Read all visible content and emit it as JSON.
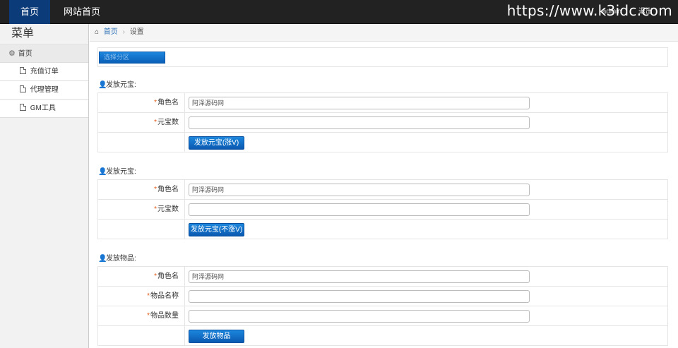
{
  "topbar": {
    "home": "首页",
    "site_home": "网站首页",
    "right_link_1": "admin",
    "right_link_2": "退出",
    "watermark": "https://www.k3idc.com"
  },
  "sidebar": {
    "title": "菜单",
    "home": "首页",
    "items": [
      {
        "label": "充值订单"
      },
      {
        "label": "代理管理"
      },
      {
        "label": "GM工具"
      }
    ]
  },
  "breadcrumb": {
    "home": "首页",
    "separator": "›",
    "current": "设置"
  },
  "server": {
    "placeholder": "选择分区"
  },
  "sections": [
    {
      "title": "发放元宝:",
      "rows": [
        {
          "label": "角色名",
          "value": "阿泽源码网"
        },
        {
          "label": "元宝数",
          "value": ""
        }
      ],
      "button": "发放元宝(涨V)"
    },
    {
      "title": "发放元宝:",
      "rows": [
        {
          "label": "角色名",
          "value": "阿泽源码网"
        },
        {
          "label": "元宝数",
          "value": ""
        }
      ],
      "button": "发放元宝(不涨V)"
    },
    {
      "title": "发放物品:",
      "rows": [
        {
          "label": "角色名",
          "value": "阿泽源码网"
        },
        {
          "label": "物品名称",
          "value": ""
        },
        {
          "label": "物品数量",
          "value": ""
        }
      ],
      "button": "发放物品"
    }
  ],
  "required_mark": "*",
  "colors": {
    "topbar_bg": "#222222",
    "active_nav": "#0b3b78",
    "button_blue": "#0b59b0",
    "required": "#e25b1a",
    "link": "#2a6fb5"
  }
}
